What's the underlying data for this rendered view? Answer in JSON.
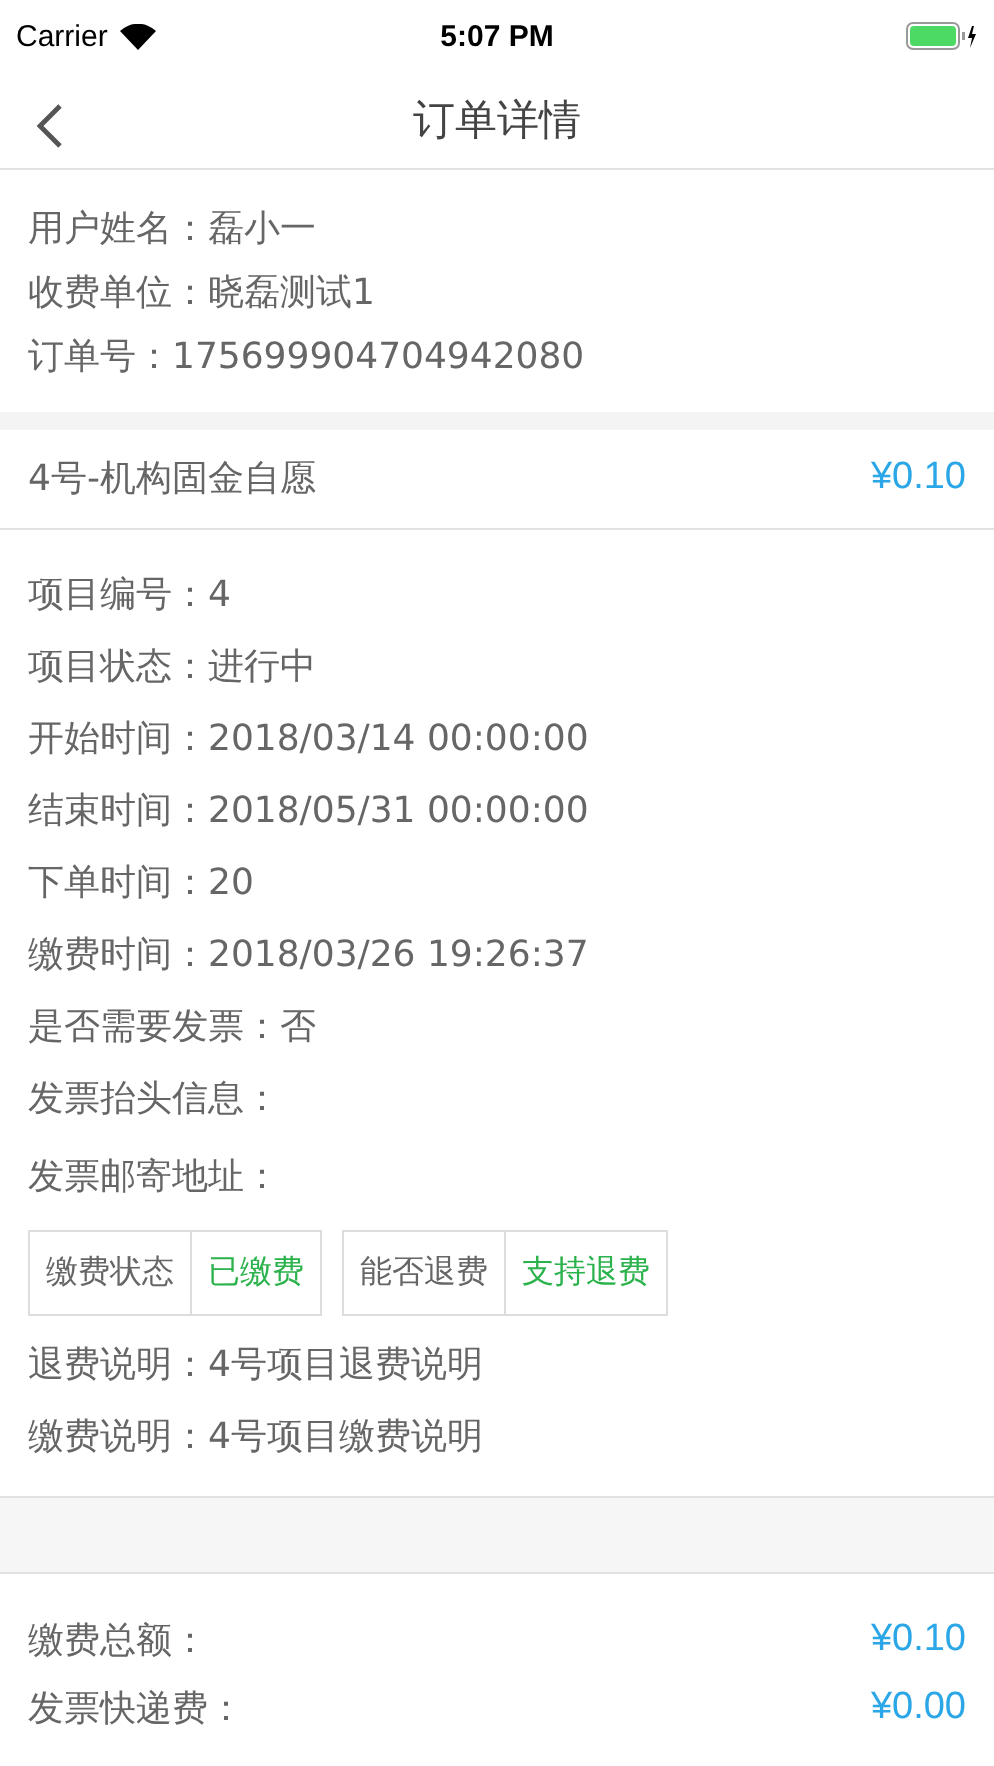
{
  "status_bar": {
    "carrier": "Carrier",
    "time": "5:07 PM"
  },
  "nav": {
    "title": "订单详情"
  },
  "user_info": [
    {
      "label": "用户姓名：",
      "value": "磊小一"
    },
    {
      "label": "收费单位：",
      "value": "晓磊测试1"
    },
    {
      "label": "订单号：",
      "value": "175699904704942080"
    }
  ],
  "project": {
    "name": "4号-机构固金自愿",
    "price": "¥0.10"
  },
  "details": [
    {
      "label": "项目编号：",
      "value": "4"
    },
    {
      "label": "项目状态：",
      "value": "进行中"
    },
    {
      "label": "开始时间：",
      "value": "2018/03/14 00:00:00"
    },
    {
      "label": "结束时间：",
      "value": "2018/05/31 00:00:00"
    },
    {
      "label": "下单时间：",
      "value": "20"
    },
    {
      "label": "缴费时间：",
      "value": "2018/03/26 19:26:37"
    },
    {
      "label": "是否需要发票：",
      "value": "否"
    },
    {
      "label": "发票抬头信息："
    },
    {
      "label": "发票邮寄地址："
    }
  ],
  "tags": [
    {
      "label": "缴费状态",
      "value": "已缴费"
    },
    {
      "label": "能否退费",
      "value": "支持退费"
    }
  ],
  "notes": [
    {
      "label": "退费说明：",
      "value": "4号项目退费说明"
    },
    {
      "label": "缴费说明：",
      "value": "4号项目缴费说明"
    }
  ],
  "totals": [
    {
      "label": "缴费总额：",
      "value": "¥0.10"
    },
    {
      "label": "发票快递费：",
      "value": "¥0.00"
    }
  ]
}
